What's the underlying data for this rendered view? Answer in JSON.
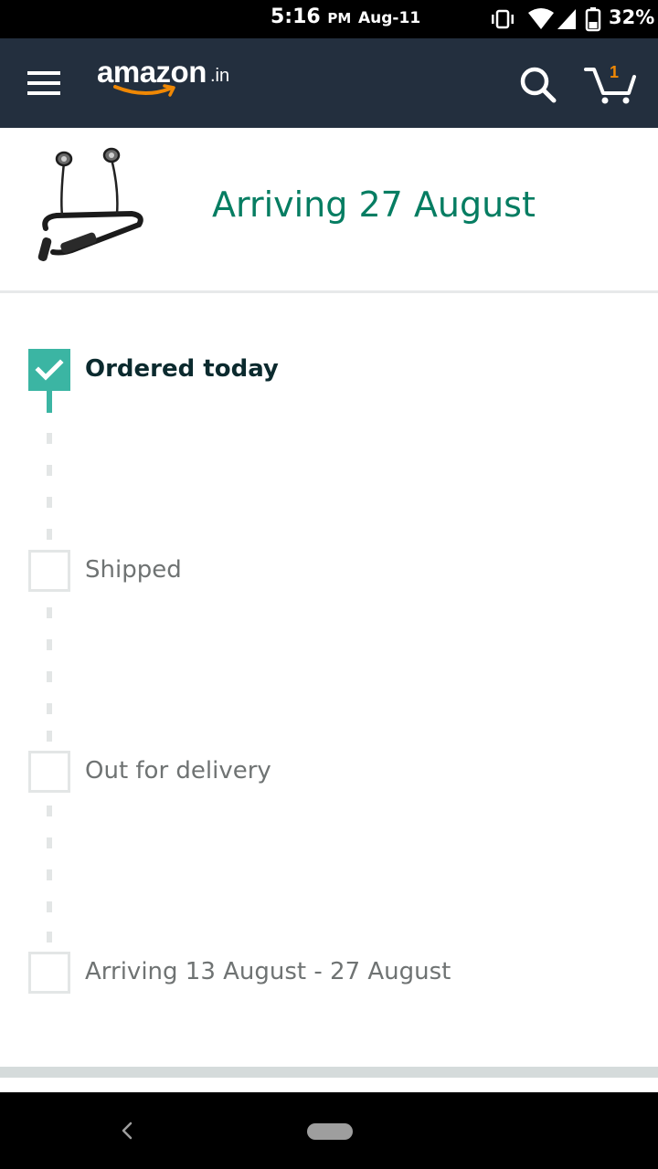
{
  "status_bar": {
    "time": "5:16",
    "ampm": "PM",
    "date": "Aug-11",
    "battery": "32%",
    "icons": [
      "vibrate-icon",
      "wifi-icon",
      "signal-icon",
      "battery-icon"
    ]
  },
  "header": {
    "logo_text": "amazon",
    "logo_tld": ".in",
    "cart_count": "1",
    "background": "#232f3e",
    "icons": [
      "menu-icon",
      "search-icon",
      "cart-icon"
    ]
  },
  "product": {
    "image": "earphones-image",
    "arriving_title": "Arriving 27 August",
    "title_color": "#067d62"
  },
  "timeline": {
    "accent_color": "#3bb5a3",
    "steps": [
      {
        "label": "Ordered today",
        "done": true
      },
      {
        "label": "Shipped",
        "done": false
      },
      {
        "label": "Out for delivery",
        "done": false
      },
      {
        "label": "Arriving 13 August - 27 August",
        "done": false
      }
    ]
  },
  "nav_bar": {
    "icons": [
      "back-icon",
      "home-pill-icon"
    ]
  }
}
